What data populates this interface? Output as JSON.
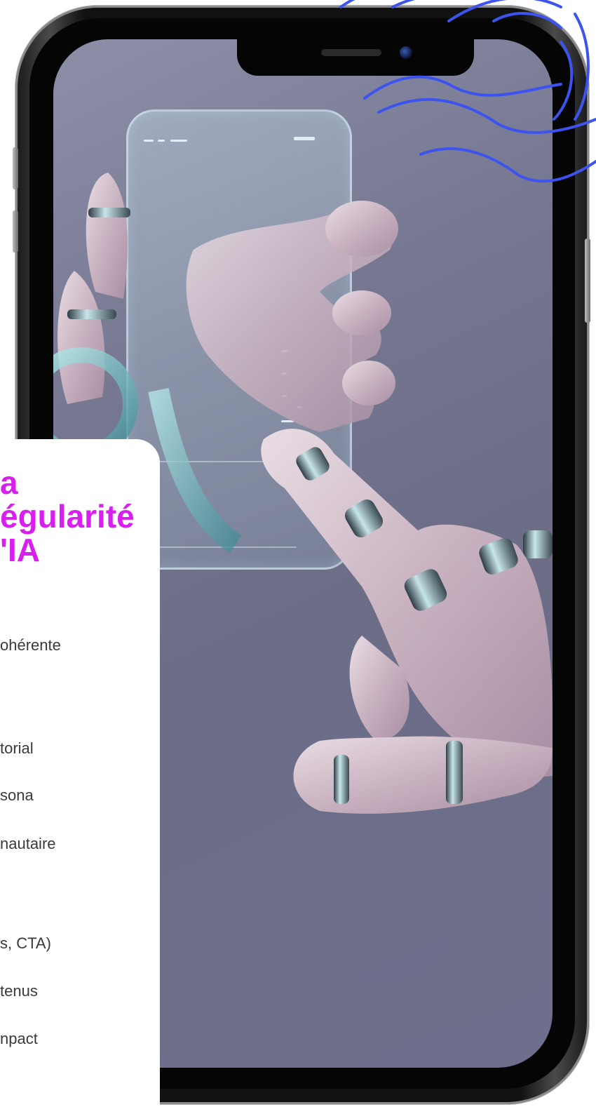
{
  "card": {
    "title_lines": [
      "a",
      "égularité",
      "'IA"
    ],
    "items": [
      "ohérente",
      "torial",
      "sona",
      "nautaire",
      "s, CTA)",
      "tenus",
      "npact"
    ]
  },
  "colors": {
    "title": "#d91ff0",
    "screen_bg": "#767892",
    "waves": "#3d53ef",
    "phone_frame": "#111111"
  },
  "icons": {
    "waves": "wavy-lines-decoration",
    "camera": "front-camera-icon"
  }
}
